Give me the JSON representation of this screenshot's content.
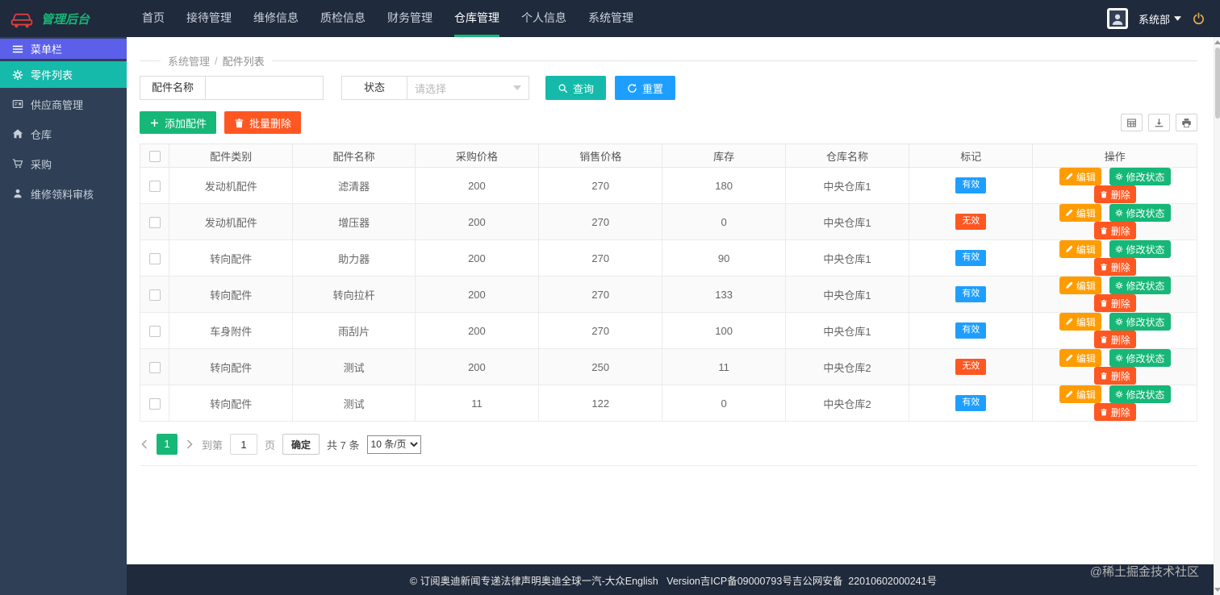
{
  "navbar": {
    "brand": "管理后台",
    "items": [
      {
        "label": "首页",
        "active": false
      },
      {
        "label": "接待管理",
        "active": false
      },
      {
        "label": "维修信息",
        "active": false
      },
      {
        "label": "质检信息",
        "active": false
      },
      {
        "label": "财务管理",
        "active": false
      },
      {
        "label": "仓库管理",
        "active": true
      },
      {
        "label": "个人信息",
        "active": false
      },
      {
        "label": "系统管理",
        "active": false
      }
    ],
    "user": {
      "department": "系统部"
    }
  },
  "sidebar": {
    "items": [
      {
        "label": "菜单栏",
        "icon": "menu-icon",
        "type": "header",
        "active": false
      },
      {
        "label": "零件列表",
        "icon": "parts-icon",
        "type": "item",
        "active": true
      },
      {
        "label": "供应商管理",
        "icon": "supplier-icon",
        "type": "item",
        "active": false
      },
      {
        "label": "仓库",
        "icon": "warehouse-icon",
        "type": "item",
        "active": false
      },
      {
        "label": "采购",
        "icon": "purchase-icon",
        "type": "item",
        "active": false
      },
      {
        "label": "维修领料审核",
        "icon": "audit-icon",
        "type": "item",
        "active": false
      }
    ]
  },
  "breadcrumb": {
    "parent": "系统管理",
    "separator": "/",
    "current": "配件列表"
  },
  "filters": {
    "name_label": "配件名称",
    "name_value": "",
    "status_label": "状态",
    "status_placeholder": "请选择",
    "search_label": "查询",
    "reset_label": "重置"
  },
  "toolbar": {
    "add_label": "添加配件",
    "batch_delete_label": "批量删除"
  },
  "table": {
    "columns": [
      "配件类别",
      "配件名称",
      "采购价格",
      "销售价格",
      "库存",
      "仓库名称",
      "标记",
      "操作"
    ],
    "row_actions": {
      "edit": "编辑",
      "modify_status": "修改状态",
      "delete": "删除"
    },
    "rows": [
      {
        "category": "发动机配件",
        "name": "滤清器",
        "purchase_price": "200",
        "sale_price": "270",
        "stock": "180",
        "warehouse": "中央仓库1",
        "status": "有效",
        "status_type": "valid"
      },
      {
        "category": "发动机配件",
        "name": "增压器",
        "purchase_price": "200",
        "sale_price": "270",
        "stock": "0",
        "warehouse": "中央仓库1",
        "status": "无效",
        "status_type": "invalid"
      },
      {
        "category": "转向配件",
        "name": "助力器",
        "purchase_price": "200",
        "sale_price": "270",
        "stock": "90",
        "warehouse": "中央仓库1",
        "status": "有效",
        "status_type": "valid"
      },
      {
        "category": "转向配件",
        "name": "转向拉杆",
        "purchase_price": "200",
        "sale_price": "270",
        "stock": "133",
        "warehouse": "中央仓库1",
        "status": "有效",
        "status_type": "valid"
      },
      {
        "category": "车身附件",
        "name": "雨刮片",
        "purchase_price": "200",
        "sale_price": "270",
        "stock": "100",
        "warehouse": "中央仓库1",
        "status": "有效",
        "status_type": "valid"
      },
      {
        "category": "转向配件",
        "name": "测试",
        "purchase_price": "200",
        "sale_price": "250",
        "stock": "11",
        "warehouse": "中央仓库2",
        "status": "无效",
        "status_type": "invalid"
      },
      {
        "category": "转向配件",
        "name": "测试",
        "purchase_price": "11",
        "sale_price": "122",
        "stock": "0",
        "warehouse": "中央仓库2",
        "status": "有效",
        "status_type": "valid"
      }
    ]
  },
  "pagination": {
    "current_page": "1",
    "goto_prefix": "到第",
    "goto_value": "1",
    "goto_suffix": "页",
    "confirm_label": "确定",
    "total_text": "共 7 条",
    "page_size": "10 条/页"
  },
  "footer": {
    "text": "© 订阅奥迪新闻专递法律声明奥迪全球一汽-大众English   Version吉ICP备09000793号吉公网安备  22010602000241号"
  },
  "watermark": "@稀土掘金技术社区",
  "colors": {
    "navbar_bg": "#1f2a3c",
    "sidebar_bg": "#2f4056",
    "brand_green": "#16b777",
    "menu_purple": "#5b5fe9",
    "active_teal": "#16baaa",
    "primary_blue": "#1e9fff",
    "green": "#16b777",
    "orange": "#ff9c00",
    "red": "#ff5722"
  }
}
